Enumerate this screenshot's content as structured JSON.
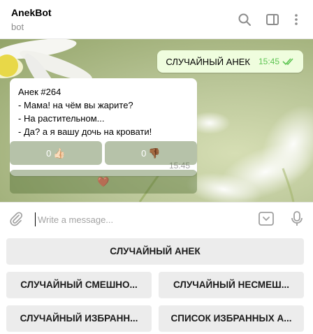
{
  "header": {
    "title": "AnekBot",
    "subtitle": "bot",
    "icons": [
      "search-icon",
      "sidebar-toggle-icon",
      "more-vertical-icon"
    ]
  },
  "messages": {
    "outgoing": {
      "text": "СЛУЧАЙНЫЙ АНЕК",
      "time": "15:45",
      "status": "read"
    },
    "incoming": {
      "lines": [
        "Анек #264",
        "- Мама! на чём вы жарите?",
        "- На растительном...",
        "- Да? а я вашу дочь на кровати!"
      ],
      "time": "15:45"
    }
  },
  "inline_keyboard": {
    "like_count": "0",
    "like_emoji": "👍🏻",
    "dislike_count": "0",
    "dislike_emoji": "👎🏾",
    "favorite_emoji": "🤎"
  },
  "composer": {
    "placeholder": "Write a message...",
    "value": ""
  },
  "reply_keyboard": {
    "row1": [
      "СЛУЧАЙНЫЙ АНЕК"
    ],
    "row2": [
      "СЛУЧАЙНЫЙ СМЕШНО...",
      "СЛУЧАЙНЫЙ НЕСМЕШ..."
    ],
    "row3": [
      "СЛУЧАЙНЫЙ ИЗБРАНН...",
      "СПИСОК ИЗБРАННЫХ А..."
    ]
  },
  "colors": {
    "outgoing_bubble": "#effdde",
    "read_ticks": "#5dc452",
    "inline_button_bg": "rgba(80,110,50,0.42)",
    "keyboard_button_bg": "#ececec"
  }
}
